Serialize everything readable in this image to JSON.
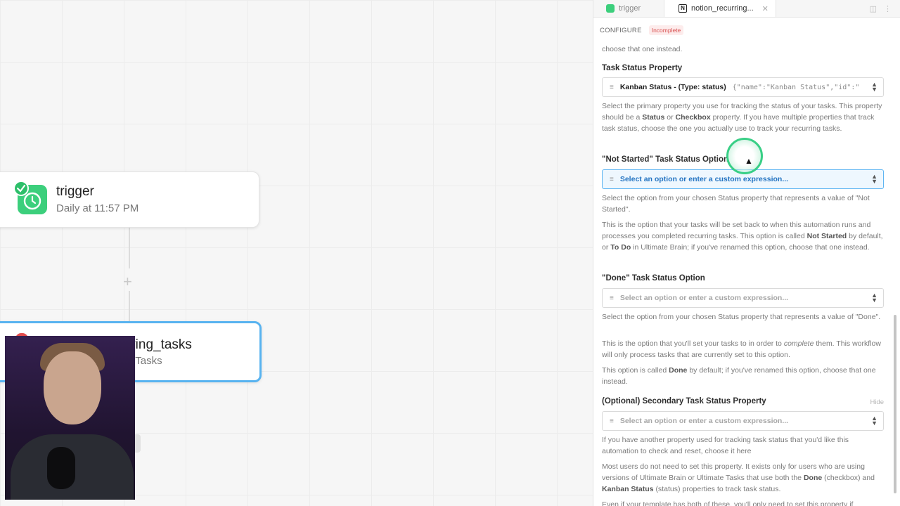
{
  "canvas": {
    "trigger_node": {
      "title": "trigger",
      "subtitle": "Daily at 11:57 PM"
    },
    "step_node": {
      "title": "rring_tasks",
      "subtitle": "g Tasks"
    },
    "add_step_icon": "plus-icon"
  },
  "panel": {
    "tabs": [
      {
        "label": "trigger",
        "icon": "pipedream-icon"
      },
      {
        "label": "notion_recurring...",
        "icon": "notion-icon"
      }
    ],
    "configure_label": "CONFIGURE",
    "status_badge": "Incomplete",
    "intro_tail": "choose that one instead.",
    "task_status_property": {
      "label": "Task Status Property",
      "value": "Kanban Status - (Type: status)",
      "value_code": "{\"name\":\"Kanban Status\",\"id\":\"",
      "desc_1": "Select the primary property you use for tracking the status of your tasks. This property should be a",
      "desc_status": "Status",
      "desc_or": "or",
      "desc_checkbox": "Checkbox",
      "desc_2": "property. If you have multiple properties that track task status, choose the one you actually use to track your recurring tasks."
    },
    "not_started_option": {
      "label": "\"Not Started\" Task Status Option",
      "placeholder": "Select an option or enter a custom expression...",
      "desc_1": "Select the option from your chosen Status property that represents a value of \"Not Started\".",
      "desc_2a": "This is the option that your tasks will be set back to when this automation runs and processes you completed recurring tasks. This option is called",
      "desc_2b": "Not Started",
      "desc_2c": "by default, or",
      "desc_2d": "To Do",
      "desc_2e": "in Ultimate Brain; if you've renamed this option, choose that one instead."
    },
    "done_option": {
      "label": "\"Done\" Task Status Option",
      "placeholder": "Select an option or enter a custom expression...",
      "desc_1": "Select the option from your chosen Status property that represents a value of \"Done\".",
      "desc_2a": "This is the option that you'll set your tasks to in order to",
      "desc_2b": "complete",
      "desc_2c": "them. This workflow will only process tasks that are currently set to this option.",
      "desc_3a": "This option is called",
      "desc_3b": "Done",
      "desc_3c": "by default; if you've renamed this option, choose that one instead."
    },
    "secondary_property": {
      "label": "(Optional) Secondary Task Status Property",
      "hide_label": "Hide",
      "placeholder": "Select an option or enter a custom expression...",
      "desc_1": "If you have another property used for tracking task status that you'd like this automation to check and reset, choose it here",
      "desc_2a": "Most users do not need to set this property. It exists only for users who are using versions of Ultimate Brain or Ultimate Tasks that use both the",
      "desc_2b": "Done",
      "desc_2c": "(checkbox) and",
      "desc_2d": "Kanban Status",
      "desc_2e": "(status) properties to track task status.",
      "desc_3": "Even if your template has both of these, you'll only need to set this property if"
    }
  },
  "colors": {
    "accent_green": "#3ccf7c",
    "selected_blue": "#58b3f0",
    "badge_red": "#d85050"
  }
}
